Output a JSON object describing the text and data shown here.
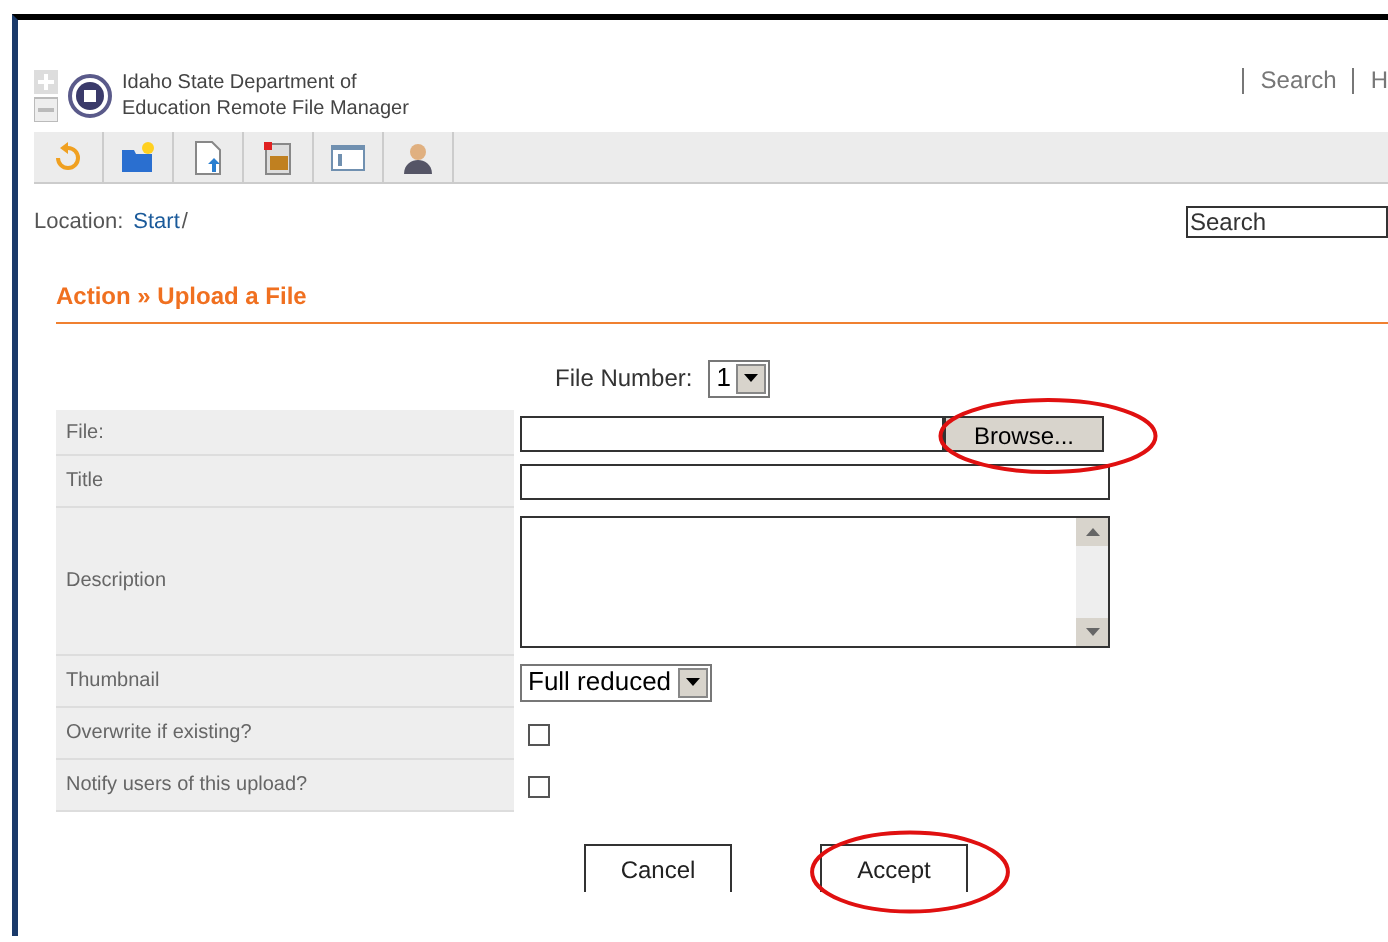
{
  "header": {
    "title_lines": [
      "Idaho State Department of",
      "Education Remote File Manager"
    ],
    "links": [
      "Search",
      "H"
    ]
  },
  "toolbar": [
    {
      "kind": "back"
    },
    {
      "kind": "new-folder"
    },
    {
      "kind": "upload"
    },
    {
      "kind": "image"
    },
    {
      "kind": "window"
    },
    {
      "kind": "user"
    }
  ],
  "location": {
    "label": "Location:",
    "path": "Start",
    "separator": "/"
  },
  "search": {
    "placeholder": "Search"
  },
  "heading": "Action » Upload a File",
  "file_number": {
    "label": "File Number:",
    "value": "1"
  },
  "form_rows": [
    {
      "label": "File:",
      "kind": "file",
      "button": "Browse...",
      "highlighted": true
    },
    {
      "label": "Title",
      "kind": "text"
    },
    {
      "label": "Description",
      "kind": "textarea"
    },
    {
      "label": "Thumbnail",
      "kind": "select",
      "value": "Full reduced"
    },
    {
      "label": "Overwrite if existing?",
      "kind": "checkbox",
      "checked": false
    },
    {
      "label": "Notify users of this upload?",
      "kind": "checkbox",
      "checked": false
    }
  ],
  "buttons": [
    {
      "label": "Cancel",
      "highlighted": false
    },
    {
      "label": "Accept",
      "highlighted": true
    }
  ]
}
